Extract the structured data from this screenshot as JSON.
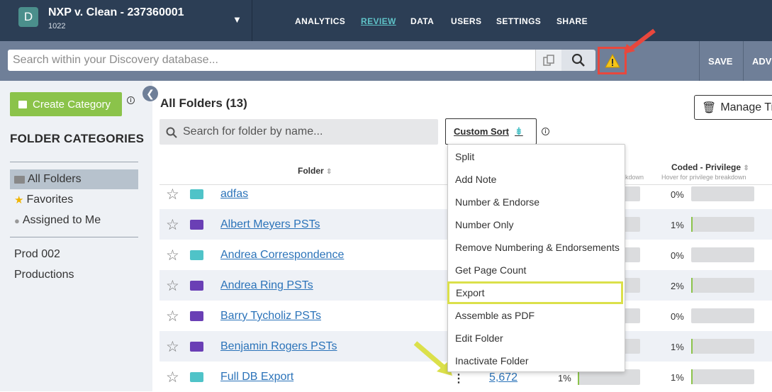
{
  "header": {
    "case_badge": "D",
    "case_name": "NXP v. Clean - 237360001",
    "case_id": "1022",
    "nav": [
      "ANALYTICS",
      "REVIEW",
      "DATA",
      "USERS",
      "SETTINGS",
      "SHARE"
    ],
    "active_nav": "REVIEW"
  },
  "search": {
    "placeholder": "Search within your Discovery database...",
    "save_label": "SAVE",
    "adv_label": "ADV"
  },
  "sidebar": {
    "create_label": "Create Category",
    "title": "FOLDER CATEGORIES",
    "items": [
      "All Folders",
      "Favorites",
      "Assigned to Me"
    ],
    "productions": [
      "Prod 002",
      "Productions"
    ]
  },
  "main": {
    "title": "All Folders (13)",
    "manage_label": "Manage Tra",
    "folder_search_placeholder": "Search for folder by name...",
    "sort_label": "Custom Sort",
    "col_folder": "Folder",
    "col_privilege": "Coded - Privilege",
    "col_privilege_sub": "Hover for privilege breakdown",
    "col_partial_sub": "kdown",
    "rows": [
      {
        "name": "adfas",
        "color": "#4fc3c8",
        "priv_pct": "0%",
        "priv_fill": 0
      },
      {
        "name": "Albert Meyers PSTs",
        "color": "#6a3fb5",
        "priv_pct": "1%",
        "priv_fill": 0.01
      },
      {
        "name": "Andrea Correspondence",
        "color": "#4fc3c8",
        "priv_pct": "0%",
        "priv_fill": 0
      },
      {
        "name": "Andrea Ring PSTs",
        "color": "#6a3fb5",
        "priv_pct": "2%",
        "priv_fill": 0.02
      },
      {
        "name": "Barry Tycholiz PSTs",
        "color": "#6a3fb5",
        "priv_pct": "0%",
        "priv_fill": 0
      },
      {
        "name": "Benjamin Rogers PSTs",
        "color": "#6a3fb5",
        "priv_pct": "1%",
        "priv_fill": 0.01
      },
      {
        "name": "Full DB Export",
        "color": "#4fc3c8",
        "priv_pct": "1%",
        "priv_fill": 0.01
      }
    ],
    "last_row_count": "5,672",
    "last_row_mid_pct": "1%"
  },
  "menu": {
    "items": [
      "Split",
      "Add Note",
      "Number & Endorse",
      "Number Only",
      "Remove Numbering & Endorsements",
      "Get Page Count",
      "Export",
      "Assemble as PDF",
      "Edit Folder",
      "Inactivate Folder"
    ],
    "highlighted": "Export"
  },
  "colors": {
    "topbar": "#2c3e55",
    "accent_green": "#8bc34a",
    "link_blue": "#2b73b9",
    "warning_red": "#e8473d",
    "highlight_yellow": "#dbe04a"
  }
}
